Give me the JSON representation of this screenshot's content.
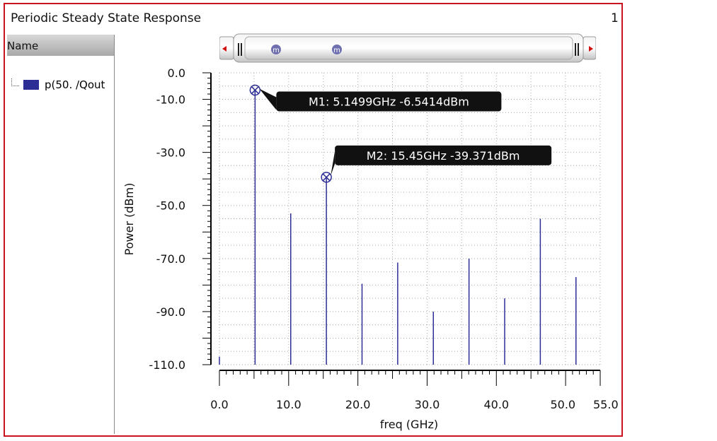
{
  "window": {
    "title": "Periodic Steady State Response",
    "index": "1"
  },
  "panel": {
    "header": "Name",
    "items": [
      {
        "label": "p(50. /Qout",
        "color": "#2d2d96"
      }
    ]
  },
  "chart_data": {
    "type": "bar",
    "xlabel": "freq (GHz)",
    "ylabel": "Power (dBm)",
    "xlim": [
      0,
      55
    ],
    "ylim": [
      -110,
      0
    ],
    "xticks": [
      "0.0",
      "10.0",
      "20.0",
      "30.0",
      "40.0",
      "50.0",
      "55.0"
    ],
    "yticks": [
      "0.0",
      "-10.0",
      "-30.0",
      "-50.0",
      "-70.0",
      "-90.0",
      "-110.0"
    ],
    "grid": true,
    "series": [
      {
        "name": "p(50. /Qout",
        "color": "#2d2d96",
        "x": [
          0,
          5.15,
          10.3,
          15.45,
          20.6,
          25.75,
          30.9,
          36.05,
          41.2,
          46.35,
          51.5
        ],
        "y": [
          -107,
          -6.5414,
          -53,
          -39.371,
          -79.5,
          -71.5,
          -90,
          -70,
          -85,
          -55,
          -77
        ]
      }
    ],
    "markers": [
      {
        "label": "M1: 5.1499GHz -6.5414dBm",
        "x": 5.1499,
        "y": -6.5414
      },
      {
        "label": "M2: 15.45GHz -39.371dBm",
        "x": 15.45,
        "y": -39.371
      }
    ]
  }
}
